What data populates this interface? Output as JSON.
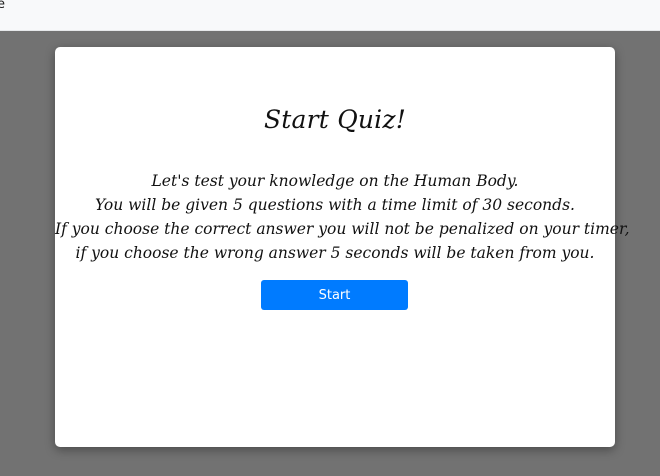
{
  "topbar": {
    "partial_text": "e"
  },
  "modal": {
    "title": "Start Quiz!",
    "body_lines": [
      "Let's test your knowledge on the Human Body.",
      "You will be given 5 questions with a time limit of 30 seconds.",
      "If you choose the correct answer you will not be penalized on your timer,",
      "if you choose the wrong answer 5 seconds will be taken from you."
    ],
    "start_button_label": "Start"
  },
  "colors": {
    "overlay": "#727272",
    "button": "#007bff",
    "topbar": "#f8f9fa"
  }
}
